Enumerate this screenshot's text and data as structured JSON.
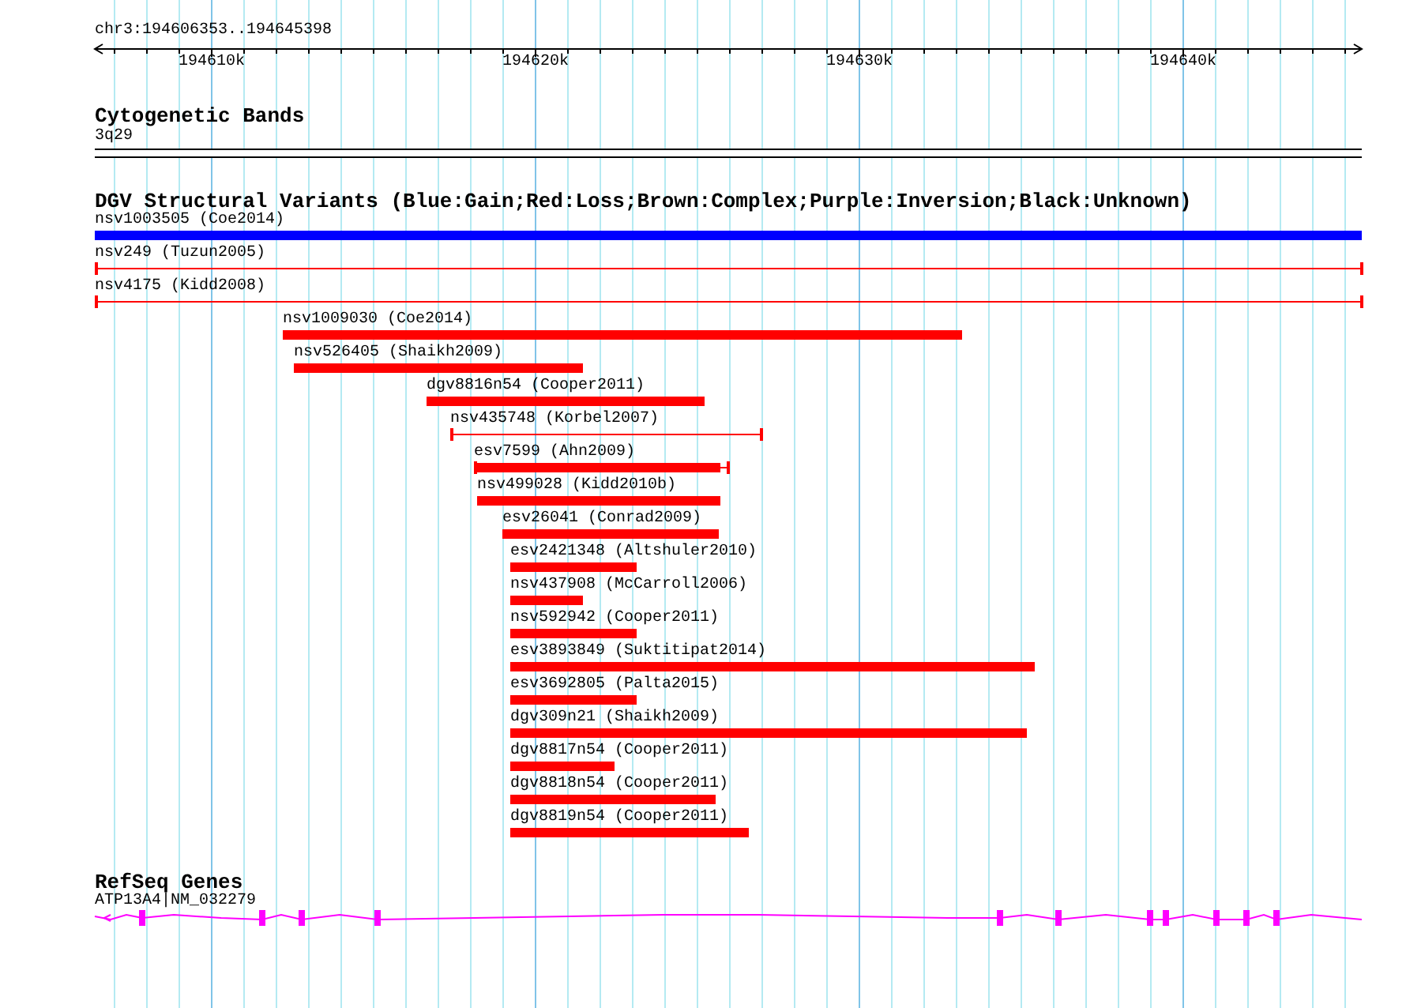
{
  "ruler": {
    "location": "chr3:194606353..194645398",
    "ticks": [
      "194610k",
      "194620k",
      "194630k",
      "194640k"
    ]
  },
  "cytogenetic_bands": {
    "title": "Cytogenetic Bands",
    "band": "3q29"
  },
  "structural_variants": {
    "title": "DGV Structural Variants (Blue:Gain;Red:Loss;Brown:Complex;Purple:Inversion;Black:Unknown)",
    "variants": [
      {
        "label": "nsv1003505 (Coe2014)",
        "color": "#0000ff",
        "kind": "bar"
      },
      {
        "label": "nsv249 (Tuzun2005)",
        "color": "#ff0000",
        "kind": "line"
      },
      {
        "label": "nsv4175 (Kidd2008)",
        "color": "#ff0000",
        "kind": "line"
      },
      {
        "label": "nsv1009030 (Coe2014)",
        "color": "#ff0000",
        "kind": "bar"
      },
      {
        "label": "nsv526405 (Shaikh2009)",
        "color": "#ff0000",
        "kind": "bar"
      },
      {
        "label": "dgv8816n54 (Cooper2011)",
        "color": "#ff0000",
        "kind": "bar"
      },
      {
        "label": "nsv435748 (Korbel2007)",
        "color": "#ff0000",
        "kind": "line"
      },
      {
        "label": "esv7599 (Ahn2009)",
        "color": "#ff0000",
        "kind": "capped-bar"
      },
      {
        "label": "nsv499028 (Kidd2010b)",
        "color": "#ff0000",
        "kind": "bar"
      },
      {
        "label": "esv26041 (Conrad2009)",
        "color": "#ff0000",
        "kind": "bar"
      },
      {
        "label": "esv2421348 (Altshuler2010)",
        "color": "#ff0000",
        "kind": "bar"
      },
      {
        "label": "nsv437908 (McCarroll2006)",
        "color": "#ff0000",
        "kind": "bar"
      },
      {
        "label": "nsv592942 (Cooper2011)",
        "color": "#ff0000",
        "kind": "bar"
      },
      {
        "label": "esv3893849 (Suktitipat2014)",
        "color": "#ff0000",
        "kind": "bar"
      },
      {
        "label": "esv3692805 (Palta2015)",
        "color": "#ff0000",
        "kind": "bar"
      },
      {
        "label": "dgv309n21 (Shaikh2009)",
        "color": "#ff0000",
        "kind": "bar"
      },
      {
        "label": "dgv8817n54 (Cooper2011)",
        "color": "#ff0000",
        "kind": "bar"
      },
      {
        "label": "dgv8818n54 (Cooper2011)",
        "color": "#ff0000",
        "kind": "bar"
      },
      {
        "label": "dgv8819n54 (Cooper2011)",
        "color": "#ff0000",
        "kind": "bar"
      }
    ]
  },
  "refseq_genes": {
    "title": "RefSeq Genes",
    "gene": "ATP13A4|NM_032279"
  }
}
